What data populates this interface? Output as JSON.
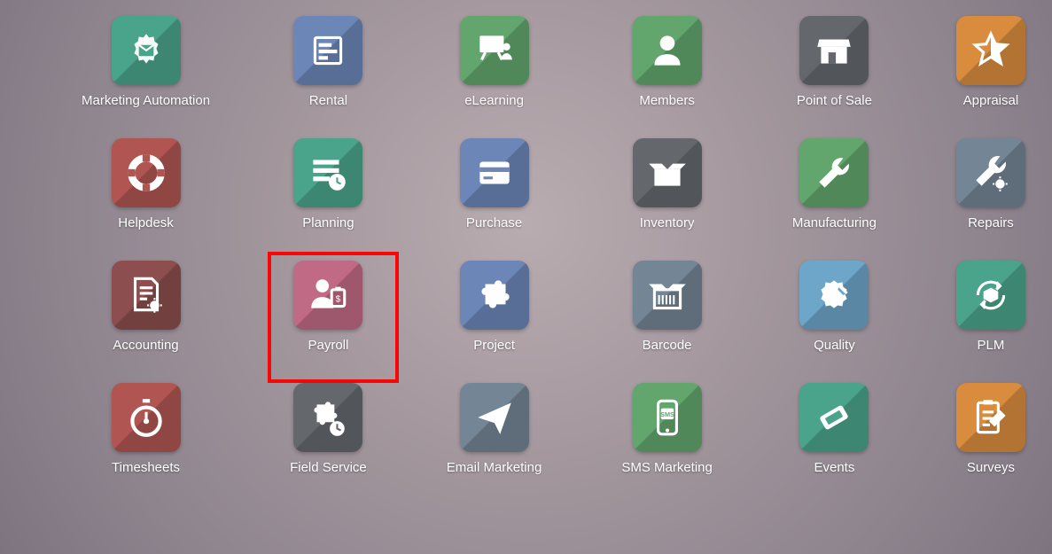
{
  "apps": [
    {
      "id": "marketing-automation",
      "label": "Marketing Automation",
      "color": "c-teal",
      "icon": "gear-mail",
      "highlighted": false
    },
    {
      "id": "rental",
      "label": "Rental",
      "color": "c-blue",
      "icon": "calendar-bars",
      "highlighted": false
    },
    {
      "id": "elearning",
      "label": "eLearning",
      "color": "c-green",
      "icon": "presentation",
      "highlighted": false
    },
    {
      "id": "members",
      "label": "Members",
      "color": "c-green",
      "icon": "person",
      "highlighted": false
    },
    {
      "id": "point-of-sale",
      "label": "Point of Sale",
      "color": "c-gray",
      "icon": "store",
      "highlighted": false
    },
    {
      "id": "appraisal",
      "label": "Appraisal",
      "color": "c-orange",
      "icon": "star",
      "highlighted": false
    },
    {
      "id": "helpdesk",
      "label": "Helpdesk",
      "color": "c-red",
      "icon": "lifebuoy",
      "highlighted": false
    },
    {
      "id": "planning",
      "label": "Planning",
      "color": "c-teal",
      "icon": "list-clock",
      "highlighted": false
    },
    {
      "id": "purchase",
      "label": "Purchase",
      "color": "c-blue",
      "icon": "card",
      "highlighted": false
    },
    {
      "id": "inventory",
      "label": "Inventory",
      "color": "c-gray",
      "icon": "box-open",
      "highlighted": false
    },
    {
      "id": "manufacturing",
      "label": "Manufacturing",
      "color": "c-green",
      "icon": "wrench",
      "highlighted": false
    },
    {
      "id": "repairs",
      "label": "Repairs",
      "color": "c-slate",
      "icon": "wrench-gear",
      "highlighted": false
    },
    {
      "id": "accounting",
      "label": "Accounting",
      "color": "c-maroon",
      "icon": "doc-gear",
      "highlighted": false
    },
    {
      "id": "payroll",
      "label": "Payroll",
      "color": "c-pink",
      "icon": "person-pay",
      "highlighted": true
    },
    {
      "id": "project",
      "label": "Project",
      "color": "c-blue",
      "icon": "puzzle",
      "highlighted": false
    },
    {
      "id": "barcode",
      "label": "Barcode",
      "color": "c-slate",
      "icon": "barcode-box",
      "highlighted": false
    },
    {
      "id": "quality",
      "label": "Quality",
      "color": "c-sky",
      "icon": "badge-pen",
      "highlighted": false
    },
    {
      "id": "plm",
      "label": "PLM",
      "color": "c-teal",
      "icon": "cycle-cube",
      "highlighted": false
    },
    {
      "id": "timesheets",
      "label": "Timesheets",
      "color": "c-red",
      "icon": "stopwatch",
      "highlighted": false
    },
    {
      "id": "field-service",
      "label": "Field Service",
      "color": "c-gray",
      "icon": "puzzle-clock",
      "highlighted": false
    },
    {
      "id": "email-marketing",
      "label": "Email Marketing",
      "color": "c-slate",
      "icon": "paper-plane",
      "highlighted": false
    },
    {
      "id": "sms-marketing",
      "label": "SMS Marketing",
      "color": "c-green",
      "icon": "phone-sms",
      "highlighted": false
    },
    {
      "id": "events",
      "label": "Events",
      "color": "c-teal",
      "icon": "ticket",
      "highlighted": false
    },
    {
      "id": "surveys",
      "label": "Surveys",
      "color": "c-orange",
      "icon": "clipboard-pen",
      "highlighted": false
    }
  ]
}
